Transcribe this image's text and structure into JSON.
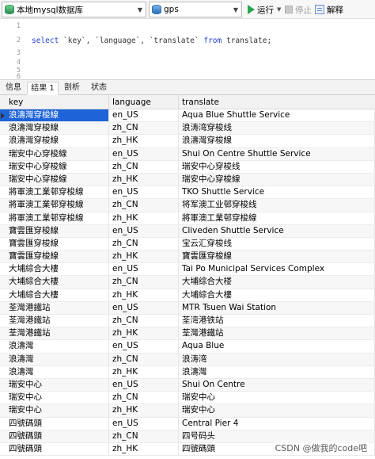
{
  "toolbar": {
    "connection": "本地mysql数据库",
    "database": "gps",
    "run_label": "运行",
    "stop_label": "停止",
    "explain_label": "解释"
  },
  "editor": {
    "line_numbers": [
      "1",
      "2",
      "3",
      "4",
      "5",
      "6"
    ],
    "kw_select": "select",
    "columns_text": " `key`, `language`, `translate` ",
    "kw_from": "from",
    "table_text": " translate;"
  },
  "tabs": [
    {
      "label": "信息"
    },
    {
      "label": "结果 1"
    },
    {
      "label": "剖析"
    },
    {
      "label": "状态"
    }
  ],
  "grid": {
    "columns": [
      "key",
      "language",
      "translate"
    ],
    "rows": [
      [
        "浪濤灣穿梭線",
        "en_US",
        "Aqua Blue Shuttle Service"
      ],
      [
        "浪濤灣穿梭線",
        "zh_CN",
        "浪涛湾穿梭线"
      ],
      [
        "浪濤灣穿梭線",
        "zh_HK",
        "浪濤灣穿梭線"
      ],
      [
        "瑞安中心穿梭線",
        "en_US",
        "Shui On Centre Shuttle Service"
      ],
      [
        "瑞安中心穿梭線",
        "zh_CN",
        "瑞安中心穿梭线"
      ],
      [
        "瑞安中心穿梭線",
        "zh_HK",
        "瑞安中心穿梭線"
      ],
      [
        "將軍澳工業邨穿梭線",
        "en_US",
        "TKO Shuttle Service"
      ],
      [
        "將軍澳工業邨穿梭線",
        "zh_CN",
        "将军澳工业邨穿梭线"
      ],
      [
        "將軍澳工業邨穿梭線",
        "zh_HK",
        "將軍澳工業邨穿梭線"
      ],
      [
        "寶雲匯穿梭線",
        "en_US",
        "Cliveden Shuttle Service"
      ],
      [
        "寶雲匯穿梭線",
        "zh_CN",
        "宝云汇穿梭线"
      ],
      [
        "寶雲匯穿梭線",
        "zh_HK",
        "寶雲匯穿梭線"
      ],
      [
        "大埔綜合大樓",
        "en_US",
        "Tai Po Municipal Services Complex"
      ],
      [
        "大埔綜合大樓",
        "zh_CN",
        "大埔综合大楼"
      ],
      [
        "大埔綜合大樓",
        "zh_HK",
        "大埔綜合大樓"
      ],
      [
        "荃灣港鐵站",
        "en_US",
        "MTR Tsuen Wai Station"
      ],
      [
        "荃灣港鐵站",
        "zh_CN",
        "荃湾港铁站"
      ],
      [
        "荃灣港鐵站",
        "zh_HK",
        "荃灣港鐵站"
      ],
      [
        "浪濤灣",
        "en_US",
        "Aqua Blue"
      ],
      [
        "浪濤灣",
        "zh_CN",
        "浪涛湾"
      ],
      [
        "浪濤灣",
        "zh_HK",
        "浪濤灣"
      ],
      [
        "瑞安中心",
        "en_US",
        "Shui On Centre"
      ],
      [
        "瑞安中心",
        "zh_CN",
        "瑞安中心"
      ],
      [
        "瑞安中心",
        "zh_HK",
        "瑞安中心"
      ],
      [
        "四號碼頭",
        "en_US",
        "Central Pier 4"
      ],
      [
        "四號碼頭",
        "zh_CN",
        "四号码头"
      ],
      [
        "四號碼頭",
        "zh_HK",
        "四號碼頭"
      ]
    ]
  },
  "watermark": "CSDN @做我的code吧"
}
